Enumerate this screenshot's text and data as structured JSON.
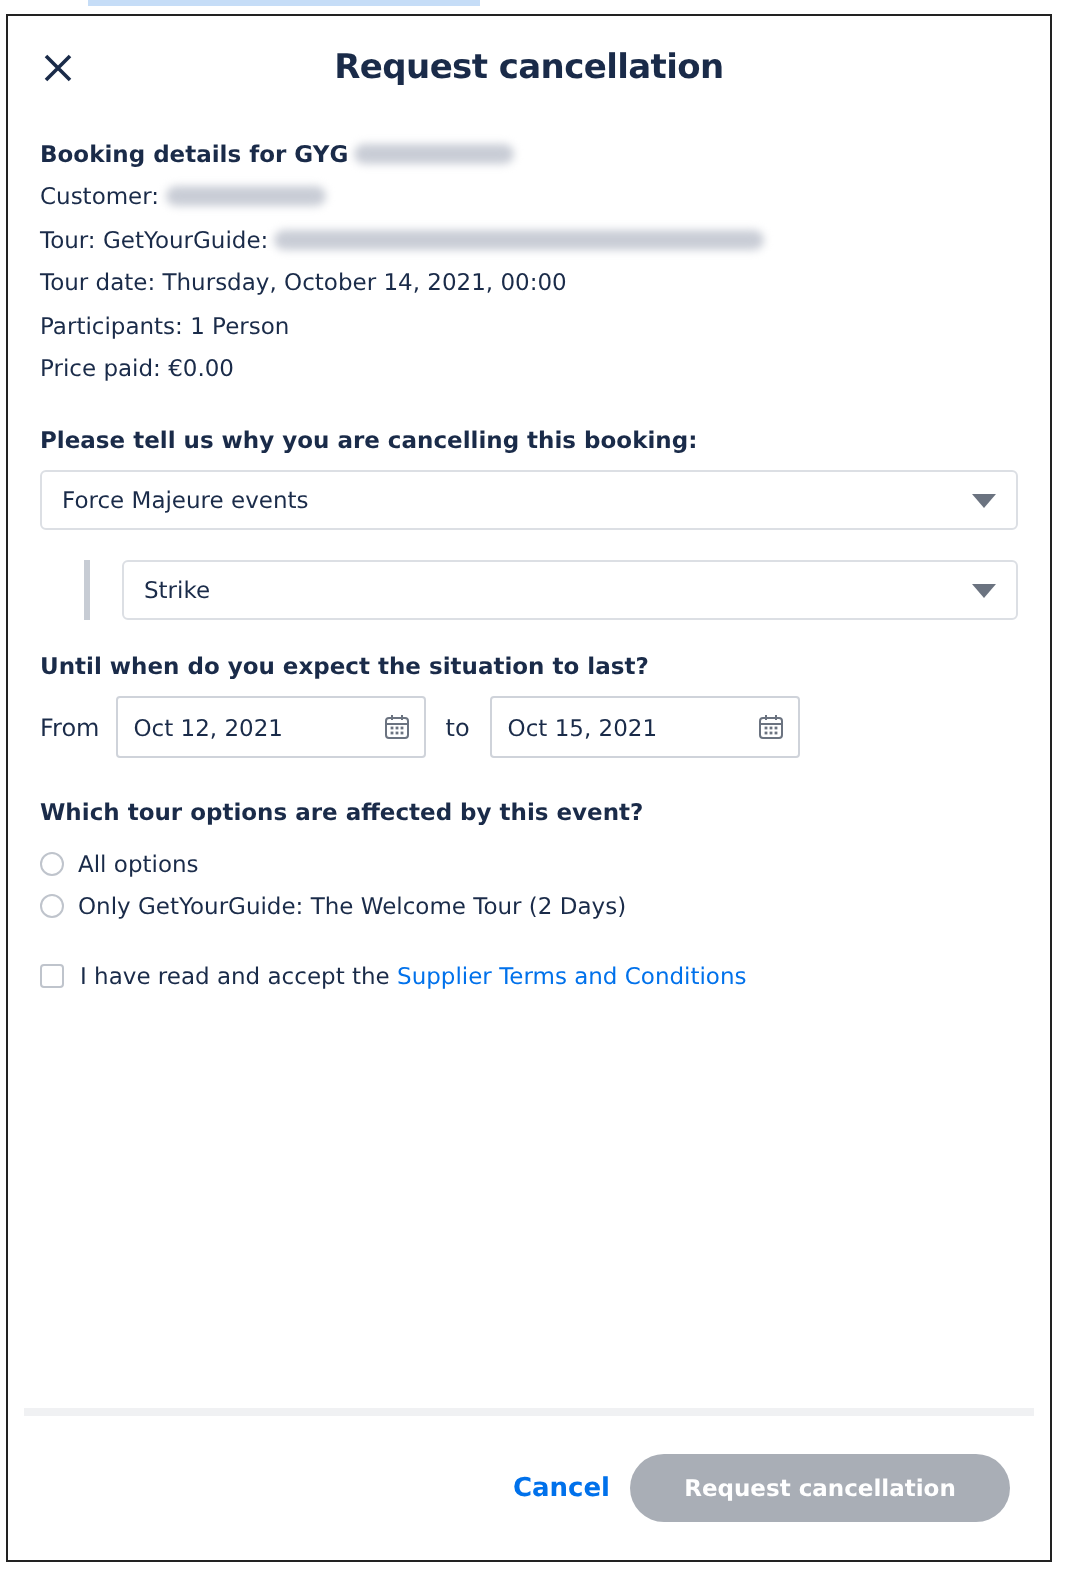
{
  "dialog": {
    "title": "Request cancellation"
  },
  "booking_details": {
    "heading": "Booking details for GYG",
    "heading_redacted": true,
    "lines": [
      {
        "label": "Customer:",
        "redacted": true
      },
      {
        "label": "Tour: GetYourGuide:",
        "redacted": true
      },
      {
        "label": "Tour date: Thursday, October 14, 2021, 00:00",
        "redacted": false
      },
      {
        "label": "Participants: 1 Person",
        "redacted": false
      },
      {
        "label": "Price paid: €0.00",
        "redacted": false
      }
    ]
  },
  "reason": {
    "question": "Please tell us why you are cancelling this booking:",
    "value": "Force Majeure events",
    "sub_value": "Strike"
  },
  "duration": {
    "question": "Until when do you expect the situation to last?",
    "from_label": "From",
    "from_value": "Oct 12, 2021",
    "to_label": "to",
    "to_value": "Oct 15, 2021"
  },
  "options": {
    "question": "Which tour options are affected by this event?",
    "items": [
      {
        "label": "All options",
        "selected": false
      },
      {
        "label": "Only GetYourGuide: The Welcome Tour (2 Days)",
        "selected": false
      }
    ]
  },
  "terms": {
    "text": "I have read and accept the ",
    "link": "Supplier Terms and Conditions",
    "checked": false
  },
  "footer": {
    "cancel": "Cancel",
    "submit": "Request cancellation",
    "submit_disabled": true
  }
}
